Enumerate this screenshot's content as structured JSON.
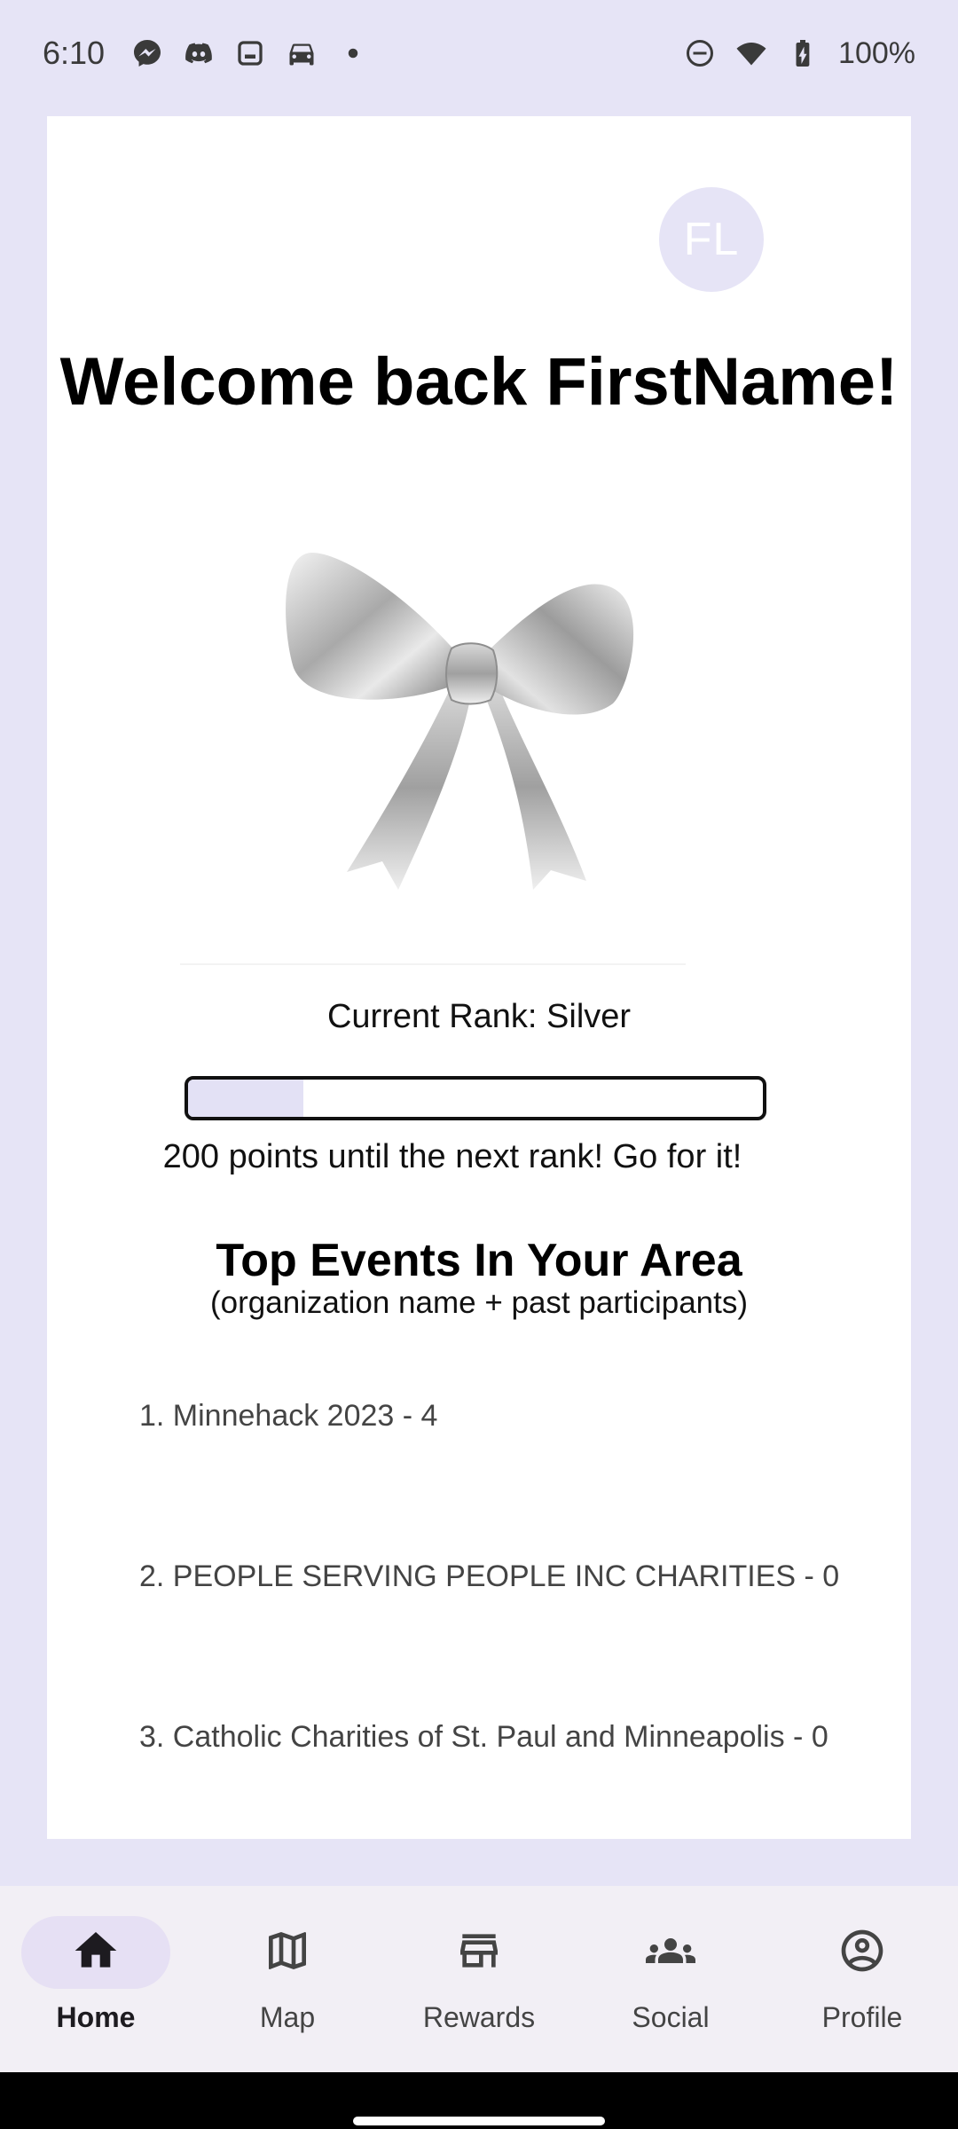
{
  "status": {
    "time": "6:10",
    "battery": "100%",
    "left_icons": [
      "messenger-icon",
      "discord-icon",
      "screenshot-icon",
      "car-icon",
      "dot-icon"
    ],
    "right_icons": [
      "do-not-disturb-icon",
      "wifi-icon",
      "battery-charging-icon"
    ]
  },
  "profile": {
    "initials": "FL",
    "avatar_color": "#e6e4f6"
  },
  "welcome": "Welcome back FirstName!",
  "rank": {
    "label": "Current Rank: Silver",
    "progress": 0.2,
    "points_text": "200 points until the next rank! Go for it!"
  },
  "events": {
    "title": "Top Events In Your Area",
    "subtitle": "(organization name + past participants)",
    "items": [
      "1. Minnehack 2023 - 4",
      "2. PEOPLE SERVING PEOPLE INC CHARITIES - 0",
      "3. Catholic Charities of St. Paul and Minneapolis - 0"
    ]
  },
  "nav": {
    "active": "Home",
    "items": [
      {
        "label": "Home",
        "icon": "home-icon"
      },
      {
        "label": "Map",
        "icon": "map-icon"
      },
      {
        "label": "Rewards",
        "icon": "store-icon"
      },
      {
        "label": "Social",
        "icon": "groups-icon"
      },
      {
        "label": "Profile",
        "icon": "account-circle-icon"
      }
    ]
  },
  "colors": {
    "background": "#e6e4f6",
    "nav_background": "#f2eff5",
    "nav_active_pill": "#e6e0f4",
    "progress_fill": "#e3e1f5"
  }
}
